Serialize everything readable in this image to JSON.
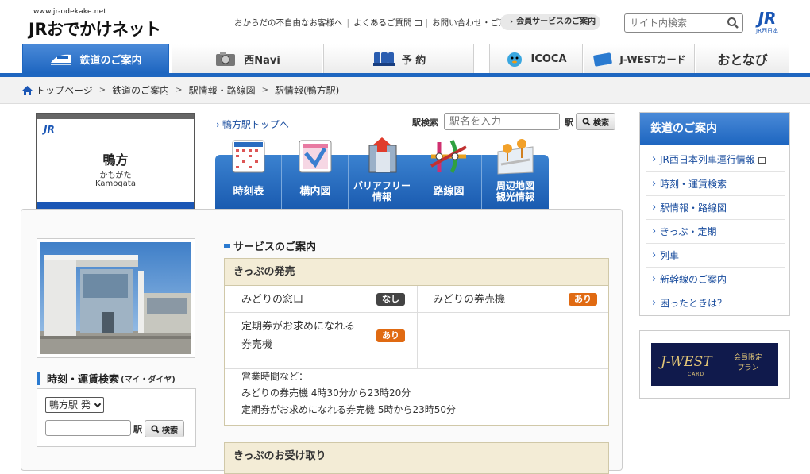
{
  "header": {
    "logo_url_text": "www.jr-odekake.net",
    "logo_text": "JRおでかけネット",
    "util_links": [
      "おからだの不自由なお客様へ",
      "よくあるご質問",
      "お問い合わせ・ご意見"
    ],
    "member_button": "会員サービスのご案内",
    "search_placeholder": "サイト内検索",
    "jr_logo": "JR",
    "jr_logo_sub": "JR西日本"
  },
  "gnav": {
    "tabs": [
      {
        "label": "鉄道のご案内",
        "active": true
      },
      {
        "label": "西Navi"
      },
      {
        "label": "予 約"
      },
      {
        "label": "ICOCA"
      },
      {
        "label": "J-WESTカード"
      },
      {
        "label": "おとなび"
      }
    ]
  },
  "breadcrumb": [
    "トップページ",
    "鉄道のご案内",
    "駅情報・路線図",
    "駅情報(鴨方駅)"
  ],
  "station": {
    "sign_mark": "JR",
    "name": "鴨方",
    "kana": "かもがた",
    "romaji": "Kamogata",
    "top_link": "鴨方駅トップへ"
  },
  "station_search": {
    "label": "駅検索",
    "placeholder": "駅名を入力",
    "eki": "駅",
    "button": "検索"
  },
  "station_tabs": [
    {
      "label": "時刻表",
      "icon": "timetable-icon"
    },
    {
      "label": "構内図",
      "icon": "floor-map-icon"
    },
    {
      "label1": "バリアフリー",
      "label2": "情報",
      "icon": "barrier-free-icon"
    },
    {
      "label": "路線図",
      "icon": "route-map-icon"
    },
    {
      "label1": "周辺地図",
      "label2": "観光情報",
      "icon": "area-map-icon"
    }
  ],
  "timetable": {
    "title": "時刻・運賃検索",
    "subtitle": "(マイ・ダイヤ)",
    "departure": "鴨方駅 発",
    "eki": "駅",
    "button": "検索"
  },
  "services": {
    "heading": "サービスのご案内",
    "section1_title": "きっぷの発売",
    "items": [
      {
        "label": "みどりの窓口",
        "status": "なし"
      },
      {
        "label": "みどりの券売機",
        "status": "あり"
      },
      {
        "label1": "定期券がお求めになれる",
        "label2": "券売機",
        "status": "あり"
      }
    ],
    "hours_title": "営業時間など：",
    "hours": [
      "みどりの券売機 4時30分から23時20分",
      "定期券がお求めになれる券売機 5時から23時50分"
    ],
    "section2_title": "きっぷのお受け取り"
  },
  "sidebar": {
    "heading": "鉄道のご案内",
    "items": [
      "JR西日本列車運行情報",
      "時刻・運賃検索",
      "駅情報・路線図",
      "きっぷ・定期",
      "列車",
      "新幹線のご案内",
      "困ったときは？"
    ]
  },
  "banner": {
    "logo": "J-WEST",
    "card": "CARD",
    "text1": "会員限定",
    "text2": "プラン"
  },
  "colors": {
    "brand_blue": "#1e66c0",
    "status_none": "#444444",
    "status_available": "#e06a12"
  }
}
